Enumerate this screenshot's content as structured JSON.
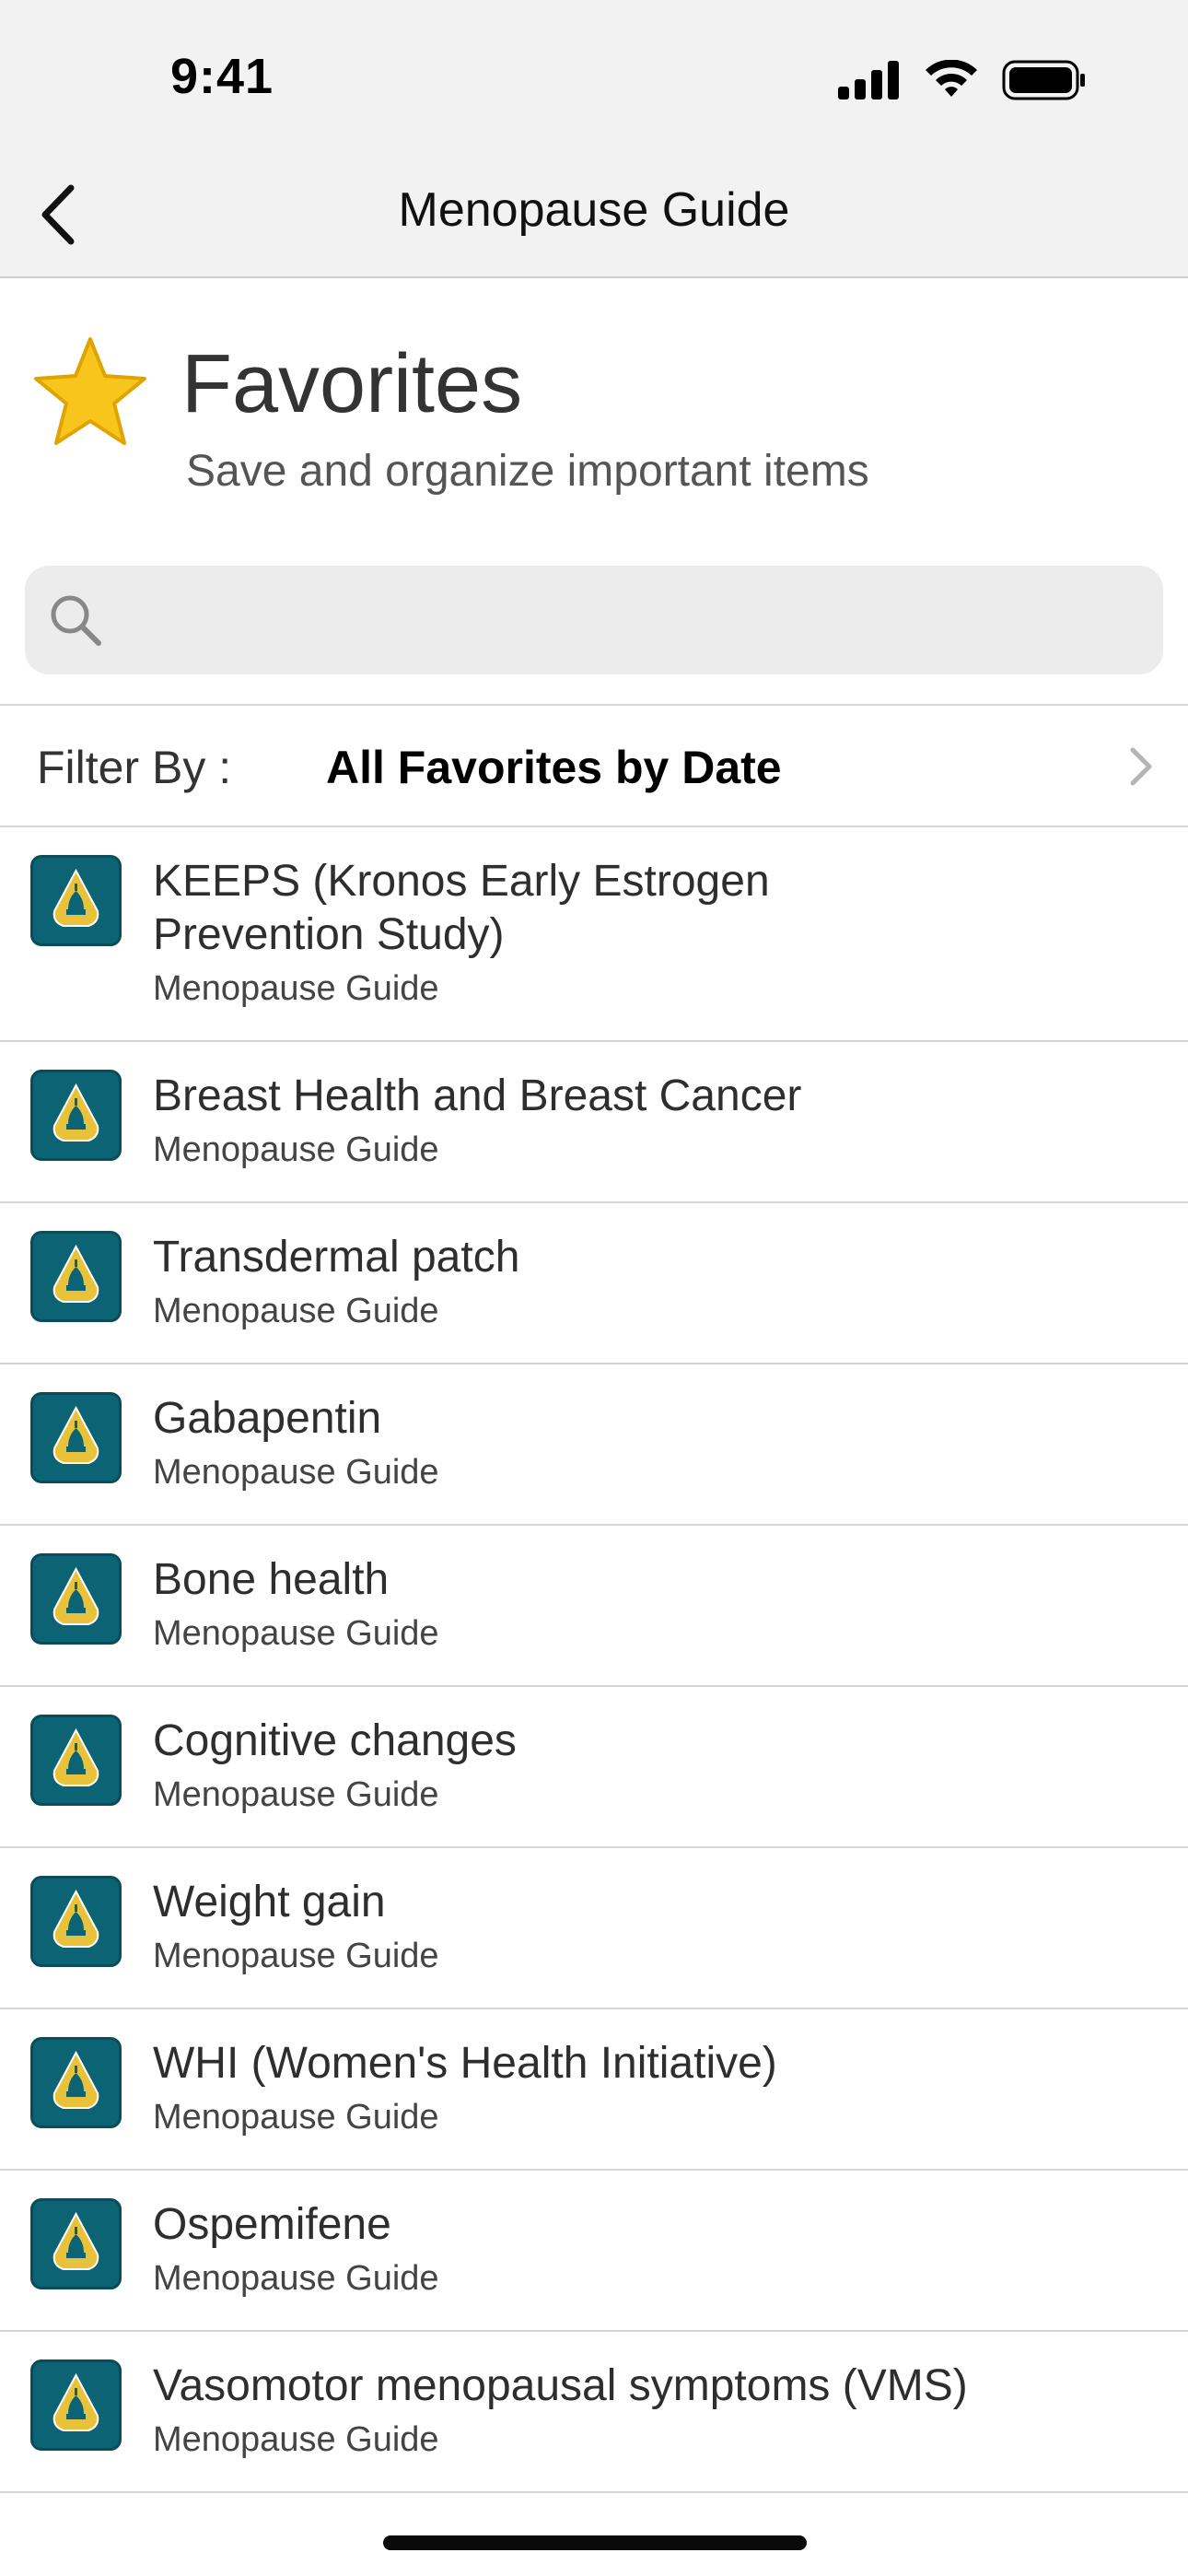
{
  "status_bar": {
    "time": "9:41"
  },
  "nav": {
    "title": "Menopause Guide"
  },
  "header": {
    "title": "Favorites",
    "subtitle": "Save and organize important items",
    "icon": "star-icon"
  },
  "search": {
    "placeholder": "",
    "value": ""
  },
  "filter": {
    "label": "Filter By :",
    "value": "All Favorites by Date"
  },
  "items": [
    {
      "title_line1": "KEEPS (Kronos Early Estrogen",
      "title_line2": "Prevention Study)",
      "source": "Menopause Guide"
    },
    {
      "title": "Breast Health and Breast Cancer",
      "source": "Menopause Guide"
    },
    {
      "title": "Transdermal patch",
      "source": "Menopause Guide"
    },
    {
      "title": "Gabapentin",
      "source": "Menopause Guide"
    },
    {
      "title": "Bone health",
      "source": "Menopause Guide"
    },
    {
      "title": "Cognitive changes",
      "source": "Menopause Guide"
    },
    {
      "title": "Weight gain",
      "source": "Menopause Guide"
    },
    {
      "title": "WHI (Women's Health Initiative)",
      "source": "Menopause Guide"
    },
    {
      "title": "Ospemifene",
      "source": "Menopause Guide"
    },
    {
      "title": "Vasomotor menopausal symptoms (VMS)",
      "source": "Menopause Guide"
    }
  ],
  "colors": {
    "app_icon_bg": "#0c6373",
    "app_icon_gold": "#e8c23a",
    "star": "#f8c51c",
    "nav_bg": "#f2f2f2",
    "search_bg": "#ececec"
  }
}
